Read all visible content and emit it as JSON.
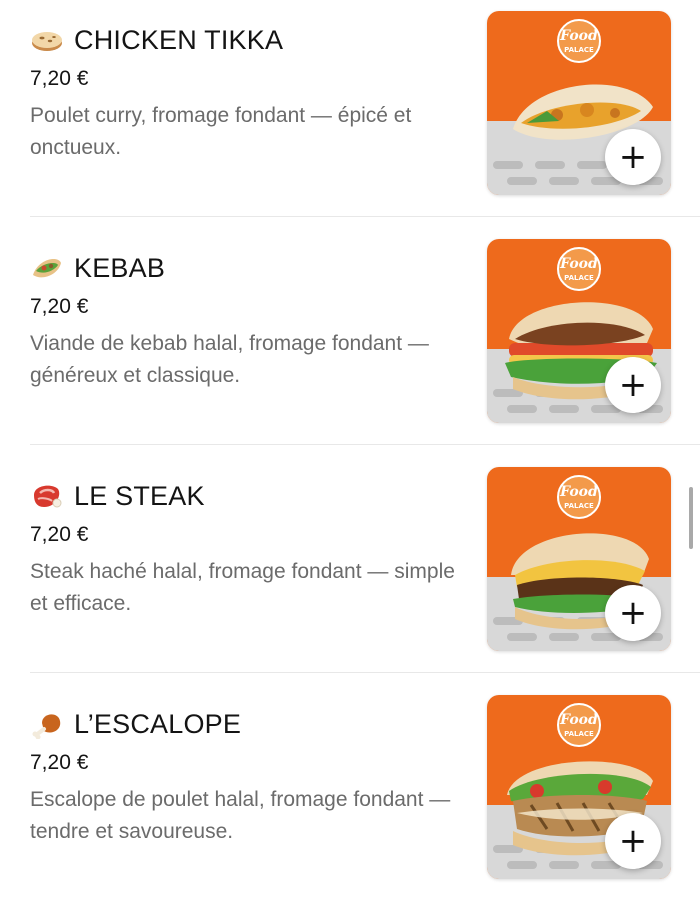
{
  "items": [
    {
      "emoji": "naan-bread-icon",
      "title": "CHICKEN TIKKA",
      "price": "7,20 €",
      "description": "Poulet curry, fromage fondant — épicé et onctueux.",
      "add_label": "+"
    },
    {
      "emoji": "stuffed-flatbread-icon",
      "title": "KEBAB",
      "price": "7,20 €",
      "description": "Viande de kebab halal, fromage fondant — généreux et classique.",
      "add_label": "+"
    },
    {
      "emoji": "cut-of-meat-icon",
      "title": "LE STEAK",
      "price": "7,20 €",
      "description": "Steak haché halal, fromage fondant — simple et efficace.",
      "add_label": "+"
    },
    {
      "emoji": "poultry-leg-icon",
      "title": "L’ESCALOPE",
      "price": "7,20 €",
      "description": "Escalope de poulet halal, fromage fondant — tendre et savoureuse.",
      "add_label": "+"
    }
  ],
  "brand": {
    "logo_line1": "Food",
    "logo_line2": "PALACE",
    "orange": "#ee6a1c",
    "tray_text": "PALACE"
  },
  "colors": {
    "title": "#141414",
    "description": "#6b6b6b",
    "divider": "#e8e8e8"
  }
}
